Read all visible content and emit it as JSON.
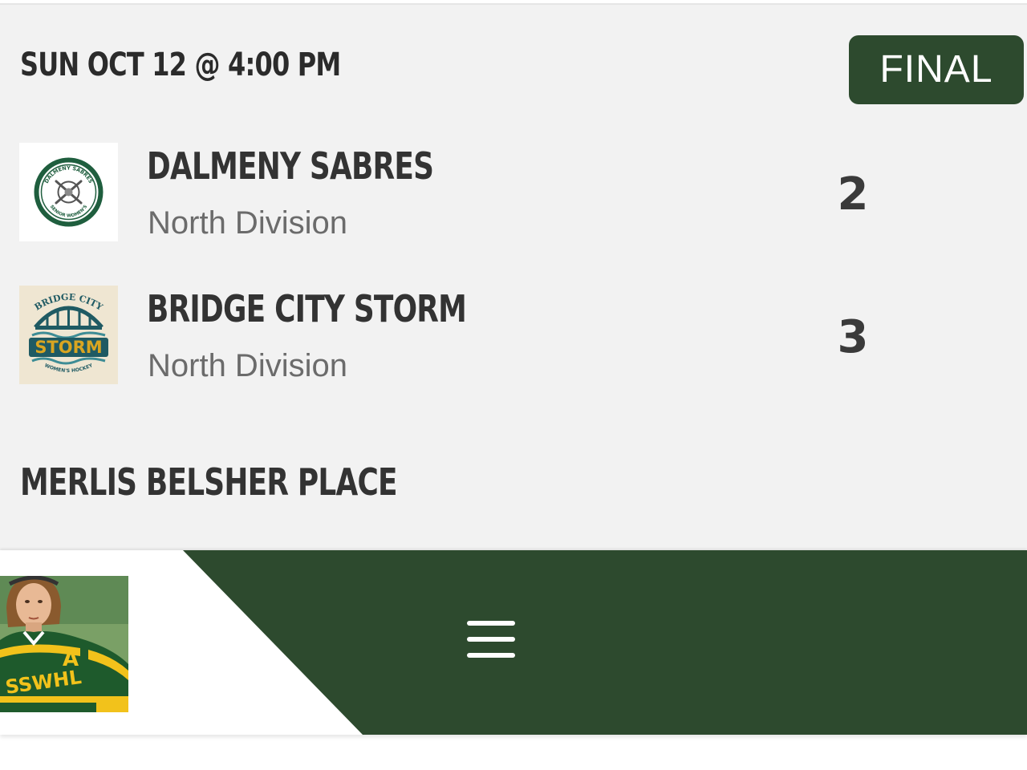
{
  "game": {
    "datetime": "SUN OCT 12 @ 4:00 PM",
    "status": "FINAL",
    "venue": "MERLIS BELSHER PLACE"
  },
  "teams": [
    {
      "name": "DALMENY SABRES",
      "division": "North Division",
      "score": "2",
      "logo_icon": "dalmeny-sabres-logo",
      "logo_text_top": "DALMENY SABRES",
      "logo_text_bottom": "SENIOR WOMEN'S"
    },
    {
      "name": "BRIDGE CITY STORM",
      "division": "North Division",
      "score": "3",
      "logo_icon": "bridge-city-storm-logo",
      "logo_text_top": "BRIDGE CITY",
      "logo_text_main": "STORM",
      "logo_text_bottom": "WOMEN'S HOCKEY"
    }
  ],
  "nav": {
    "menu_icon": "hamburger-menu-icon",
    "league_logo_icon": "sswhl-player-logo",
    "league_logo_text": "SSWHL",
    "league_logo_letter": "A"
  },
  "colors": {
    "brand_green": "#2d4a2e",
    "card_background": "#f2f2f2",
    "text_dark": "#333333",
    "text_muted": "#6b6b6b",
    "storm_gold": "#d9a521",
    "storm_teal": "#1f5a63",
    "jersey_green": "#1e5a2c",
    "jersey_yellow": "#f2c21b"
  }
}
